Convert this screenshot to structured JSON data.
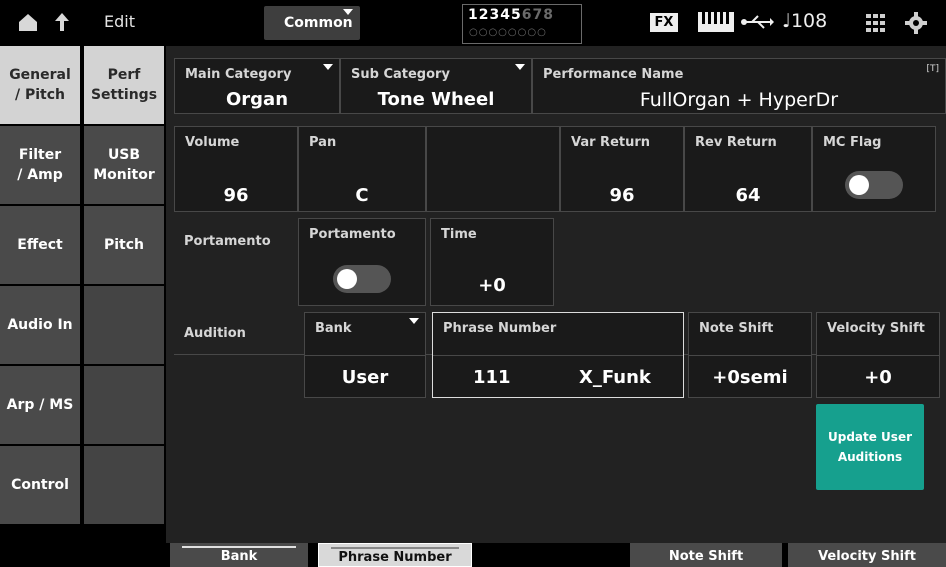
{
  "topbar": {
    "edit_label": "Edit",
    "common_tab": "Common",
    "parts_on": "12345",
    "parts_off": "678",
    "parts_dots": "○○○○○○○○",
    "fx_badge": "FX",
    "tempo": "♩108"
  },
  "left_nav": [
    {
      "label": "General\n/ Pitch",
      "selected": true
    },
    {
      "label": "Filter\n/ Amp",
      "selected": false
    },
    {
      "label": "Effect",
      "selected": false
    },
    {
      "label": "Audio In",
      "selected": false
    },
    {
      "label": "Arp / MS",
      "selected": false
    },
    {
      "label": "Control",
      "selected": false
    }
  ],
  "sub_nav": [
    {
      "label": "Perf\nSettings",
      "selected": true
    },
    {
      "label": "USB\nMonitor",
      "selected": false
    },
    {
      "label": "Pitch",
      "selected": false
    }
  ],
  "main": {
    "main_category": {
      "label": "Main Category",
      "value": "Organ"
    },
    "sub_category": {
      "label": "Sub Category",
      "value": "Tone Wheel"
    },
    "performance_name": {
      "label": "Performance Name",
      "value": "FullOrgan + HyperDr",
      "badge": "[T]"
    },
    "volume": {
      "label": "Volume",
      "value": "96"
    },
    "pan": {
      "label": "Pan",
      "value": "C"
    },
    "var_return": {
      "label": "Var Return",
      "value": "96"
    },
    "rev_return": {
      "label": "Rev Return",
      "value": "64"
    },
    "mc_flag": {
      "label": "MC Flag",
      "on": false
    },
    "portamento_row_label": "Portamento",
    "portamento_switch": {
      "label": "Portamento",
      "on": false
    },
    "portamento_time": {
      "label": "Time",
      "value": "+0"
    },
    "audition_row_label": "Audition",
    "bank": {
      "label": "Bank",
      "value": "User"
    },
    "phrase_number": {
      "label": "Phrase Number",
      "number": "111",
      "name": "X_Funk"
    },
    "note_shift": {
      "label": "Note Shift",
      "value": "+0semi"
    },
    "velocity_shift": {
      "label": "Velocity Shift",
      "value": "+0"
    },
    "update_button": "Update User\nAuditions"
  },
  "bottombar": {
    "bank": "Bank",
    "phrase_number": "Phrase Number",
    "note_shift": "Note Shift",
    "velocity_shift": "Velocity Shift"
  },
  "colors": {
    "accent": "#16a08e",
    "panel": "#222222",
    "cell": "#1a1a1a",
    "nav_selected": "#d3d3d3"
  }
}
